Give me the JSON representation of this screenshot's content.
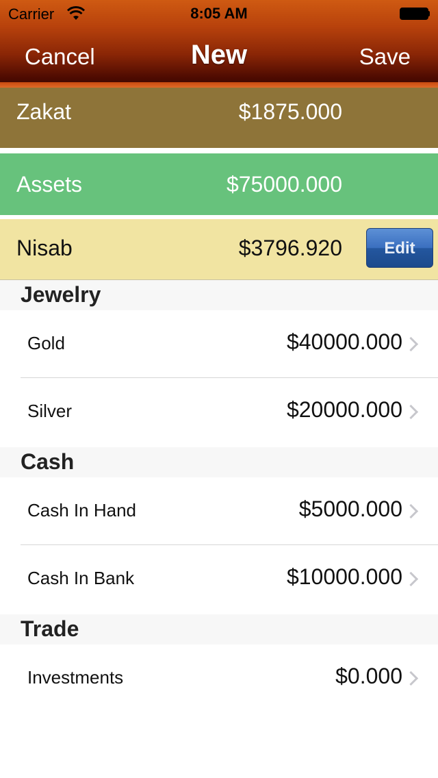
{
  "status_bar": {
    "carrier": "Carrier",
    "time": "8:05 AM",
    "wifi_icon": "wifi-icon",
    "battery_icon": "battery-icon"
  },
  "nav": {
    "cancel_label": "Cancel",
    "title": "New",
    "save_label": "Save"
  },
  "summary": {
    "zakat": {
      "label": "Zakat",
      "value": "$1875.000",
      "color": "#8e7439"
    },
    "assets": {
      "label": "Assets",
      "value": "$75000.000",
      "color": "#67c27c"
    },
    "nisab": {
      "label": "Nisab",
      "value": "$3796.920",
      "color": "#f1e4a2",
      "edit_label": "Edit"
    }
  },
  "sections": [
    {
      "title": "Jewelry",
      "items": [
        {
          "name": "Gold",
          "amount": "$40000.000"
        },
        {
          "name": "Silver",
          "amount": "$20000.000"
        }
      ]
    },
    {
      "title": "Cash",
      "items": [
        {
          "name": "Cash In Hand",
          "amount": "$5000.000"
        },
        {
          "name": "Cash In Bank",
          "amount": "$10000.000"
        }
      ]
    },
    {
      "title": "Trade",
      "items": [
        {
          "name": "Investments",
          "amount": "$0.000"
        }
      ]
    }
  ]
}
